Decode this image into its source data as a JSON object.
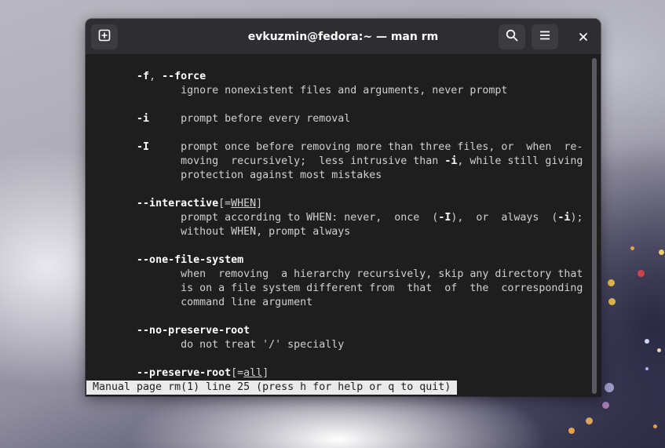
{
  "window": {
    "title": "evkuzmin@fedora:~ — man rm"
  },
  "headerbar": {
    "new_tab_icon": "new-tab-icon",
    "search_icon": "search-icon",
    "menu_icon": "hamburger-menu-icon",
    "close_icon": "close-icon"
  },
  "terminal": {
    "lines": [
      {
        "segments": [
          {
            "t": "       "
          },
          {
            "t": "-f",
            "b": true
          },
          {
            "t": ", "
          },
          {
            "t": "--force",
            "b": true
          }
        ]
      },
      {
        "segments": [
          {
            "t": "              ignore nonexistent files and arguments, never prompt"
          }
        ]
      },
      {
        "segments": [
          {
            "t": ""
          }
        ]
      },
      {
        "segments": [
          {
            "t": "       "
          },
          {
            "t": "-i",
            "b": true
          },
          {
            "t": "     prompt before every removal"
          }
        ]
      },
      {
        "segments": [
          {
            "t": ""
          }
        ]
      },
      {
        "segments": [
          {
            "t": "       "
          },
          {
            "t": "-I",
            "b": true
          },
          {
            "t": "     prompt once before removing more than three files, or  when  re‐"
          }
        ]
      },
      {
        "segments": [
          {
            "t": "              moving  recursively;  less intrusive than "
          },
          {
            "t": "-i",
            "b": true
          },
          {
            "t": ", while still giving"
          }
        ]
      },
      {
        "segments": [
          {
            "t": "              protection against most mistakes"
          }
        ]
      },
      {
        "segments": [
          {
            "t": ""
          }
        ]
      },
      {
        "segments": [
          {
            "t": "       "
          },
          {
            "t": "--interactive",
            "b": true
          },
          {
            "t": "[="
          },
          {
            "t": "WHEN",
            "u": true
          },
          {
            "t": "]"
          }
        ]
      },
      {
        "segments": [
          {
            "t": "              prompt according to WHEN: never,  once  ("
          },
          {
            "t": "-I",
            "b": true
          },
          {
            "t": "),  or  always  ("
          },
          {
            "t": "-i",
            "b": true
          },
          {
            "t": ");"
          }
        ]
      },
      {
        "segments": [
          {
            "t": "              without WHEN, prompt always"
          }
        ]
      },
      {
        "segments": [
          {
            "t": ""
          }
        ]
      },
      {
        "segments": [
          {
            "t": "       "
          },
          {
            "t": "--one-file-system",
            "b": true
          }
        ]
      },
      {
        "segments": [
          {
            "t": "              when  removing  a hierarchy recursively, skip any directory that"
          }
        ]
      },
      {
        "segments": [
          {
            "t": "              is on a file system different from  that  of  the  corresponding"
          }
        ]
      },
      {
        "segments": [
          {
            "t": "              command line argument"
          }
        ]
      },
      {
        "segments": [
          {
            "t": ""
          }
        ]
      },
      {
        "segments": [
          {
            "t": "       "
          },
          {
            "t": "--no-preserve-root",
            "b": true
          }
        ]
      },
      {
        "segments": [
          {
            "t": "              do not treat '/' specially"
          }
        ]
      },
      {
        "segments": [
          {
            "t": ""
          }
        ]
      },
      {
        "segments": [
          {
            "t": "       "
          },
          {
            "t": "--preserve-root",
            "b": true
          },
          {
            "t": "[="
          },
          {
            "t": "all",
            "u": true
          },
          {
            "t": "]"
          }
        ]
      }
    ],
    "status_line": "Manual page rm(1) line 25 (press h for help or q to quit)"
  },
  "colors": {
    "terminal_bg": "#1e1e1e",
    "headerbar_bg": "#2e2e32",
    "text": "#d0d0d0",
    "bold_text": "#ffffff",
    "status_bg": "#eaeaea"
  }
}
